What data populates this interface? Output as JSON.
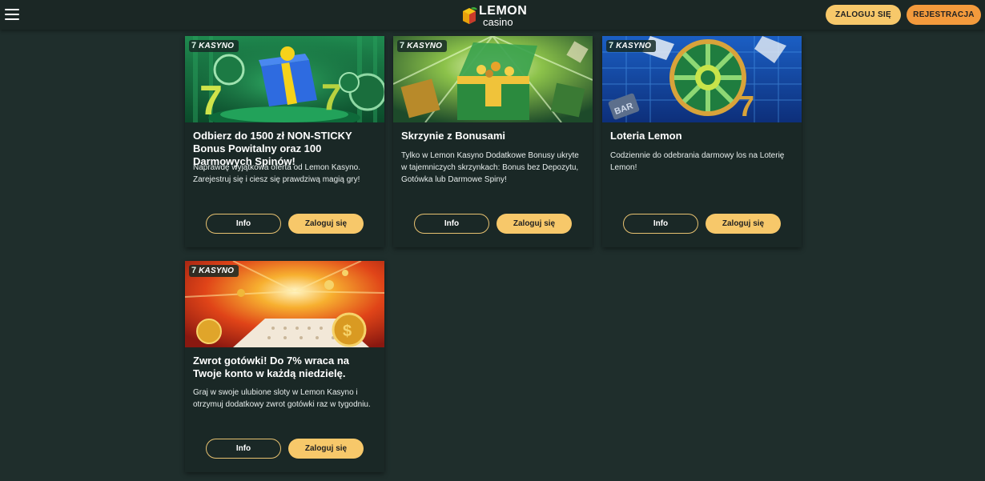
{
  "header": {
    "menu_icon": "hamburger-menu-icon",
    "logo": {
      "word": "LEMON",
      "sub": "casino"
    },
    "login_label": "ZALOGUJ SIĘ",
    "register_label": "REJESTRACJA"
  },
  "colors": {
    "background": "#1f2e2c",
    "card": "#1a2826",
    "login_button": "#f7c86a",
    "register_button": "#f39a3c",
    "info_border": "#e7c170"
  },
  "cards": [
    {
      "tag": "KASYNO",
      "tag_icon": "seven-slot-icon",
      "title": "Odbierz do 1500 zł NON-STICKY Bonus Powitalny oraz 100 Darmowych Spinów!",
      "description": "Naprawdę wyjątkowa oferta od Lemon Kasyno. Zarejestruj się i ciesz się prawdziwą magią gry!",
      "info_label": "Info",
      "login_label": "Zaloguj się"
    },
    {
      "tag": "KASYNO",
      "tag_icon": "seven-slot-icon",
      "title": "Skrzynie z Bonusami",
      "description": "Tylko w Lemon Kasyno Dodatkowe Bonusy ukryte w tajemniczych skrzynkach: Bonus bez Depozytu, Gotówka lub Darmowe Spiny!",
      "info_label": "Info",
      "login_label": "Zaloguj się"
    },
    {
      "tag": "KASYNO",
      "tag_icon": "seven-slot-icon",
      "title": "Loteria Lemon",
      "description": "Codziennie do odebrania darmowy los na Loterię Lemon!",
      "info_label": "Info",
      "login_label": "Zaloguj się"
    },
    {
      "tag": "KASYNO",
      "tag_icon": "seven-slot-icon",
      "title": "Zwrot gotówki! Do 7% wraca na Twoje konto w każdą niedzielę.",
      "description": "Graj w swoje ulubione sloty w Lemon Kasyno i otrzymuj dodatkowy zwrot gotówki raz w tygodniu.",
      "info_label": "Info",
      "login_label": "Zaloguj się"
    }
  ]
}
